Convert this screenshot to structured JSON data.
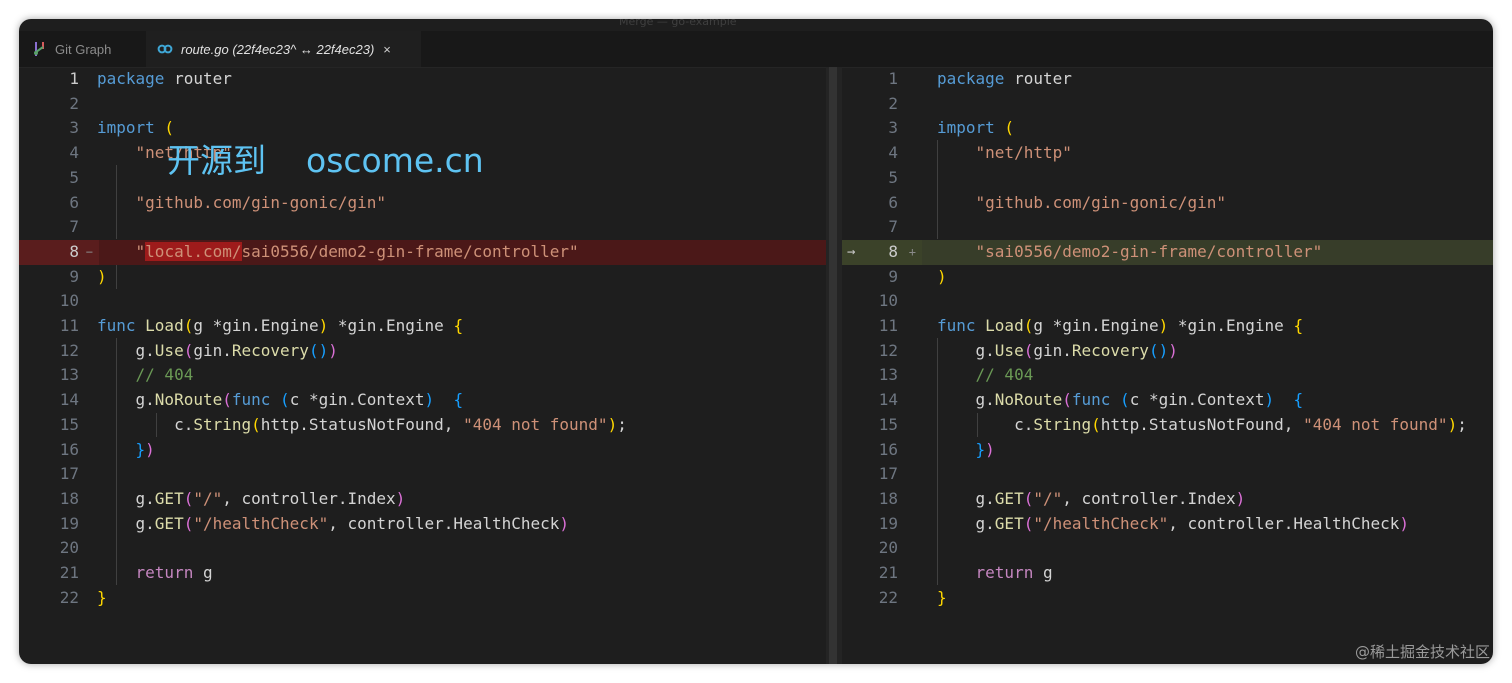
{
  "window": {
    "title": "Merge — go-example"
  },
  "tabs": [
    {
      "label": "Git Graph",
      "icon": "git-graph-icon",
      "active": false
    },
    {
      "label": "route.go (22f4ec23^ ↔ 22f4ec23)",
      "icon": "go-icon",
      "active": true,
      "close": "×"
    }
  ],
  "left_pane": {
    "lines": [
      {
        "n": "1"
      },
      {
        "n": "2"
      },
      {
        "n": "3"
      },
      {
        "n": "4"
      },
      {
        "n": "5"
      },
      {
        "n": "6"
      },
      {
        "n": "7"
      },
      {
        "n": "8",
        "marker": "−"
      },
      {
        "n": "9"
      },
      {
        "n": "10"
      },
      {
        "n": "11"
      },
      {
        "n": "12"
      },
      {
        "n": "13"
      },
      {
        "n": "14"
      },
      {
        "n": "15"
      },
      {
        "n": "16"
      },
      {
        "n": "17"
      },
      {
        "n": "18"
      },
      {
        "n": "19"
      },
      {
        "n": "20"
      },
      {
        "n": "21"
      },
      {
        "n": "22"
      }
    ],
    "code": {
      "l1_kw": "package",
      "l1_id": " router",
      "l3_kw": "import",
      "l3_p": " (",
      "l4_str": "\"net/http\"",
      "l6_str": "\"github.com/gin-gonic/gin\"",
      "l8_q": "\"",
      "l8_removed": "local.com/",
      "l8_rest": "sai0556/demo2-gin-frame/controller\"",
      "l9_p": ")",
      "l11_kw": "func",
      "l11_fn": " Load",
      "l11_p1": "(",
      "l11_args": "g *gin.Engine",
      "l11_p2": ")",
      "l11_ret": " *gin.Engine ",
      "l11_b": "{",
      "l12_a": "g.",
      "l12_fn": "Use",
      "l12_p1": "(",
      "l12_b": "gin.",
      "l12_fn2": "Recovery",
      "l12_p2": "()",
      "l12_p3": ")",
      "l13_cm": "// 404",
      "l14_a": "g.",
      "l14_fn": "NoRoute",
      "l14_p1": "(",
      "l14_kw": "func",
      "l14_sp": " ",
      "l14_p2": "(",
      "l14_args": "c *gin.Context",
      "l14_p3": ")",
      "l14_sp2": "  ",
      "l14_b": "{",
      "l15_a": "c.",
      "l15_fn": "String",
      "l15_p1": "(",
      "l15_args": "http.StatusNotFound, ",
      "l15_str": "\"404 not found\"",
      "l15_p2": ")",
      "l15_end": ";",
      "l16_b": "}",
      "l16_p": ")",
      "l18_a": "g.",
      "l18_fn": "GET",
      "l18_p1": "(",
      "l18_str": "\"/\"",
      "l18_rest": ", controller.Index",
      "l18_p2": ")",
      "l19_a": "g.",
      "l19_fn": "GET",
      "l19_p1": "(",
      "l19_str": "\"/healthCheck\"",
      "l19_rest": ", controller.HealthCheck",
      "l19_p2": ")",
      "l21_kw": "return",
      "l21_id": " g",
      "l22_b": "}"
    }
  },
  "right_pane": {
    "lines": [
      {
        "n": "1"
      },
      {
        "n": "2"
      },
      {
        "n": "3"
      },
      {
        "n": "4"
      },
      {
        "n": "5"
      },
      {
        "n": "6"
      },
      {
        "n": "7"
      },
      {
        "n": "8",
        "marker": "+",
        "arrow": "→"
      },
      {
        "n": "9"
      },
      {
        "n": "10"
      },
      {
        "n": "11"
      },
      {
        "n": "12"
      },
      {
        "n": "13"
      },
      {
        "n": "14"
      },
      {
        "n": "15"
      },
      {
        "n": "16"
      },
      {
        "n": "17"
      },
      {
        "n": "18"
      },
      {
        "n": "19"
      },
      {
        "n": "20"
      },
      {
        "n": "21"
      },
      {
        "n": "22"
      }
    ],
    "code": {
      "l1_kw": "package",
      "l1_id": " router",
      "l3_kw": "import",
      "l3_p": " (",
      "l4_str": "\"net/http\"",
      "l6_str": "\"github.com/gin-gonic/gin\"",
      "l8_str": "\"sai0556/demo2-gin-frame/controller\"",
      "l9_p": ")",
      "l11_kw": "func",
      "l11_fn": " Load",
      "l11_p1": "(",
      "l11_args": "g *gin.Engine",
      "l11_p2": ")",
      "l11_ret": " *gin.Engine ",
      "l11_b": "{",
      "l12_a": "g.",
      "l12_fn": "Use",
      "l12_p1": "(",
      "l12_b": "gin.",
      "l12_fn2": "Recovery",
      "l12_p2": "()",
      "l12_p3": ")",
      "l13_cm": "// 404",
      "l14_a": "g.",
      "l14_fn": "NoRoute",
      "l14_p1": "(",
      "l14_kw": "func",
      "l14_sp": " ",
      "l14_p2": "(",
      "l14_args": "c *gin.Context",
      "l14_p3": ")",
      "l14_sp2": "  ",
      "l14_b": "{",
      "l15_a": "c.",
      "l15_fn": "String",
      "l15_p1": "(",
      "l15_args": "http.StatusNotFound, ",
      "l15_str": "\"404 not found\"",
      "l15_p2": ")",
      "l15_end": ";",
      "l16_b": "}",
      "l16_p": ")",
      "l18_a": "g.",
      "l18_fn": "GET",
      "l18_p1": "(",
      "l18_str": "\"/\"",
      "l18_rest": ", controller.Index",
      "l18_p2": ")",
      "l19_a": "g.",
      "l19_fn": "GET",
      "l19_p1": "(",
      "l19_str": "\"/healthCheck\"",
      "l19_rest": ", controller.HealthCheck",
      "l19_p2": ")",
      "l21_kw": "return",
      "l21_id": " g",
      "l22_b": "}"
    }
  },
  "watermark": {
    "chinese": "开源到",
    "domain": "oscome.cn"
  },
  "footer_watermark": "@稀土掘金技术社区",
  "colors": {
    "keyword": "#569cd6",
    "control": "#c586c0",
    "string": "#ce9178",
    "function": "#dcdcaa",
    "comment": "#6a9955",
    "removed": "#4b1818",
    "inserted": "#373d29"
  }
}
